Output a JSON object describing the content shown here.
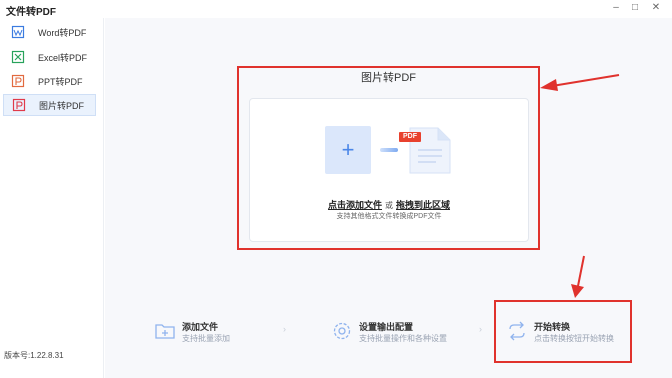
{
  "app": {
    "title": "文件转PDF"
  },
  "window_controls": {
    "minimize": "–",
    "maximize": "□",
    "close": "✕"
  },
  "sidebar": {
    "items": [
      {
        "label": "Word转PDF",
        "icon": "word-icon",
        "color": "#3b7be0"
      },
      {
        "label": "Excel转PDF",
        "icon": "excel-icon",
        "color": "#27a25b"
      },
      {
        "label": "PPT转PDF",
        "icon": "ppt-icon",
        "color": "#e26a3f"
      },
      {
        "label": "图片转PDF",
        "icon": "image-icon",
        "color": "#e03a4a",
        "active": true
      }
    ],
    "version": "版本号:1.22.8.31"
  },
  "panel": {
    "title": "图片转PDF",
    "add_button": "+",
    "pdf_tag": "PDF",
    "drop_link1": "点击添加文件",
    "drop_or": "或",
    "drop_link2": "拖拽到此区域",
    "drop_hint": "支持其他格式文件转换成PDF文件"
  },
  "steps": [
    {
      "title": "添加文件",
      "desc": "支持批量添加",
      "icon": "folder-add-icon"
    },
    {
      "title": "设置输出配置",
      "desc": "支持批量操作和各种设置",
      "icon": "settings-icon"
    },
    {
      "title": "开始转换",
      "desc": "点击转换按钮开始转换",
      "icon": "convert-icon"
    }
  ],
  "step_separator": "›",
  "colors": {
    "accent": "#4a86e8",
    "highlight_box": "#e0322d",
    "pdf_badge": "#e8412e"
  }
}
